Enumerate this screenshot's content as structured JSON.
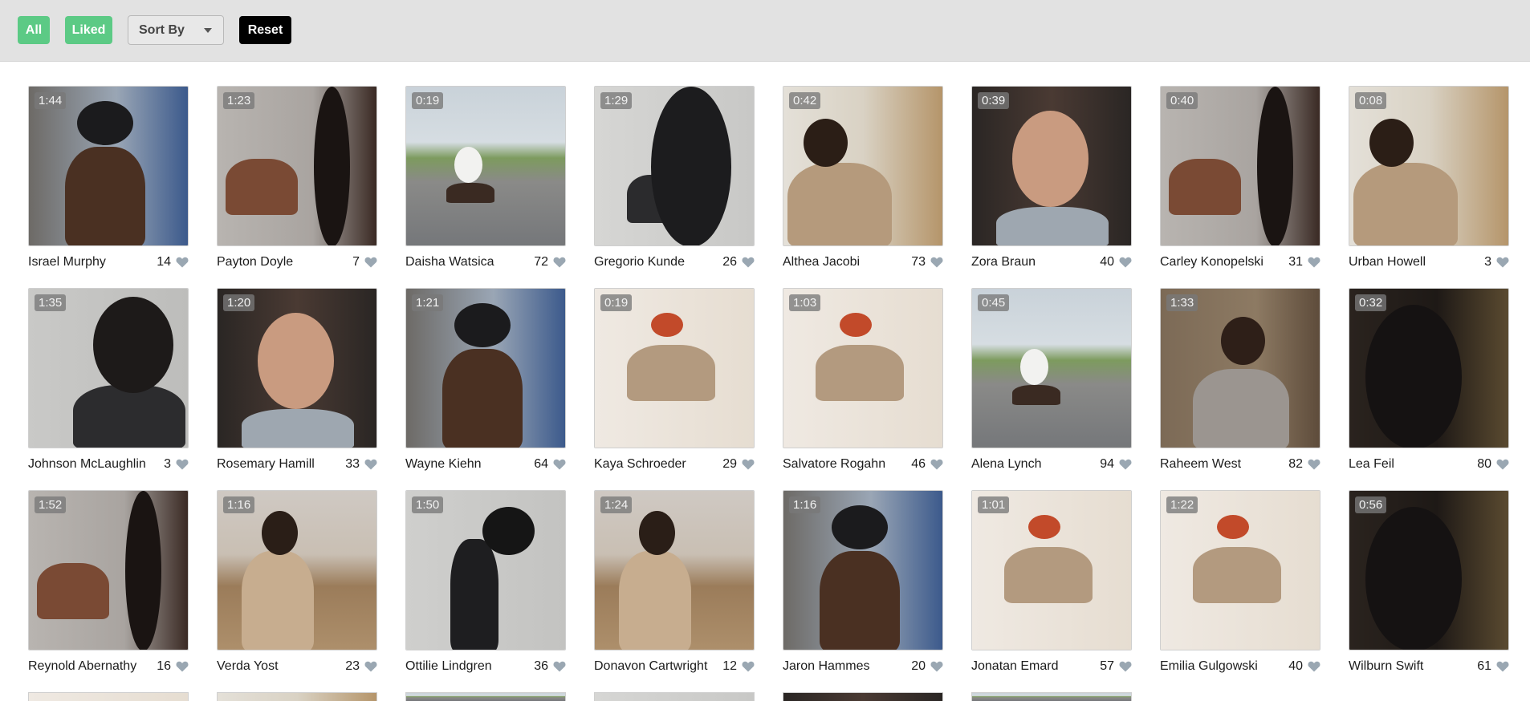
{
  "toolbar": {
    "all_label": "All",
    "liked_label": "Liked",
    "sort_label": "Sort By",
    "reset_label": "Reset"
  },
  "colors": {
    "filter_green": "#5cca85",
    "reset_black": "#000000",
    "toolbar_bg": "#e2e2e2",
    "heart": "#9aa7b2"
  },
  "videos": [
    {
      "duration": "1:44",
      "name": "Israel Murphy",
      "likes": "14",
      "scene": "beanie"
    },
    {
      "duration": "1:23",
      "name": "Payton Doyle",
      "likes": "7",
      "scene": "braid-hand"
    },
    {
      "duration": "0:19",
      "name": "Daisha Watsica",
      "likes": "72",
      "scene": "skate"
    },
    {
      "duration": "1:29",
      "name": "Gregorio Kunde",
      "likes": "26",
      "scene": "leather"
    },
    {
      "duration": "0:42",
      "name": "Althea Jacobi",
      "likes": "73",
      "scene": "sofa-drink"
    },
    {
      "duration": "0:39",
      "name": "Zora Braun",
      "likes": "40",
      "scene": "portrait"
    },
    {
      "duration": "0:40",
      "name": "Carley Konopelski",
      "likes": "31",
      "scene": "braid-hand"
    },
    {
      "duration": "0:08",
      "name": "Urban Howell",
      "likes": "3",
      "scene": "sofa-drink"
    },
    {
      "duration": "1:35",
      "name": "Johnson McLaughlin",
      "likes": "3",
      "scene": "braid-face"
    },
    {
      "duration": "1:20",
      "name": "Rosemary Hamill",
      "likes": "33",
      "scene": "portrait"
    },
    {
      "duration": "1:21",
      "name": "Wayne Kiehn",
      "likes": "64",
      "scene": "beanie"
    },
    {
      "duration": "0:19",
      "name": "Kaya Schroeder",
      "likes": "29",
      "scene": "guitar"
    },
    {
      "duration": "1:03",
      "name": "Salvatore Rogahn",
      "likes": "46",
      "scene": "guitar"
    },
    {
      "duration": "0:45",
      "name": "Alena Lynch",
      "likes": "94",
      "scene": "skate"
    },
    {
      "duration": "1:33",
      "name": "Raheem West",
      "likes": "82",
      "scene": "bed-mug"
    },
    {
      "duration": "0:32",
      "name": "Lea Feil",
      "likes": "80",
      "scene": "dark"
    },
    {
      "duration": "1:52",
      "name": "Reynold Abernathy",
      "likes": "16",
      "scene": "braid-hand"
    },
    {
      "duration": "1:16",
      "name": "Verda Yost",
      "likes": "23",
      "scene": "laptop"
    },
    {
      "duration": "1:50",
      "name": "Ottilie Lindgren",
      "likes": "36",
      "scene": "hair-flip"
    },
    {
      "duration": "1:24",
      "name": "Donavon Cartwright",
      "likes": "12",
      "scene": "laptop"
    },
    {
      "duration": "1:16",
      "name": "Jaron Hammes",
      "likes": "20",
      "scene": "beanie"
    },
    {
      "duration": "1:01",
      "name": "Jonatan Emard",
      "likes": "57",
      "scene": "guitar"
    },
    {
      "duration": "1:22",
      "name": "Emilia Gulgowski",
      "likes": "40",
      "scene": "guitar"
    },
    {
      "duration": "0:56",
      "name": "Wilburn Swift",
      "likes": "61",
      "scene": "dark"
    }
  ],
  "partial_row_scenes": [
    "guitar",
    "sofa-drink",
    "skate",
    "leather",
    "portrait",
    "skate"
  ]
}
